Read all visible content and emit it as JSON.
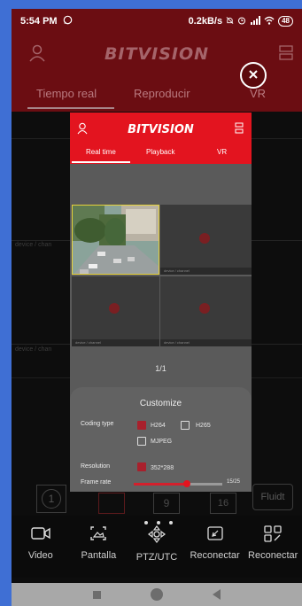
{
  "status_bar": {
    "time": "5:54 PM",
    "net_speed": "0.2kB/s",
    "battery": "48"
  },
  "app": {
    "brand": "BITVISION"
  },
  "bg_tabs": {
    "live": "Tiempo real",
    "playback": "Reproducir",
    "vr": "VR"
  },
  "bg_grid": {
    "cell_label_1": "device / chan",
    "cell_label_2": "device / chan"
  },
  "layout_row": {
    "one": "1",
    "nine": "9",
    "sixteen": "16",
    "fluency": "Fluidt"
  },
  "bottom_nav": [
    {
      "label": "Video",
      "icon": "video-icon"
    },
    {
      "label": "Pantalla",
      "icon": "screenshot-icon"
    },
    {
      "label": "PTZ/UTC",
      "icon": "ptz-icon"
    },
    {
      "label": "Reconectar",
      "icon": "reconnect-icon"
    },
    {
      "label": "Reconectar",
      "icon": "multi-reconnect-icon"
    }
  ],
  "overlay": {
    "brand": "BITVISION",
    "tabs": {
      "live": "Real time",
      "playback": "Playback",
      "vr": "VR"
    },
    "cell_label": "device / channel",
    "pager": "1/1",
    "dialog": {
      "title": "Customize",
      "coding_label": "Coding type",
      "h264": "H264",
      "h265": "H265",
      "mjpeg": "MJPEG",
      "resolution_label": "Resolution",
      "resolution_value": "352*288",
      "frame_rate_label": "Frame rate",
      "frame_rate_value": "15/25",
      "frame_rate_fraction": 0.6
    }
  },
  "colors": {
    "brand_red": "#e3141f",
    "dim_red": "#6b0d12",
    "frame_blue": "#3f6fd4"
  }
}
